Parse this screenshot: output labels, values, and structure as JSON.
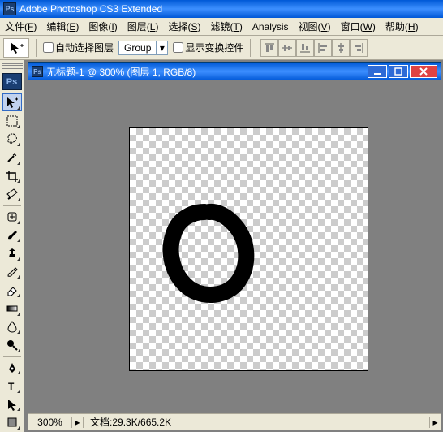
{
  "app": {
    "title": "Adobe Photoshop CS3 Extended"
  },
  "menu": [
    {
      "label": "文件",
      "acc": "F"
    },
    {
      "label": "编辑",
      "acc": "E"
    },
    {
      "label": "图像",
      "acc": "I"
    },
    {
      "label": "图层",
      "acc": "L"
    },
    {
      "label": "选择",
      "acc": "S"
    },
    {
      "label": "滤镜",
      "acc": "T"
    },
    {
      "label": "Analysis",
      "acc": ""
    },
    {
      "label": "视图",
      "acc": "V"
    },
    {
      "label": "窗口",
      "acc": "W"
    },
    {
      "label": "帮助",
      "acc": "H"
    }
  ],
  "options": {
    "auto_select_label": "自动选择图层",
    "group_value": "Group",
    "show_transform_label": "显示变换控件"
  },
  "document": {
    "title": "无标题-1 @ 300% (图层 1, RGB/8)",
    "zoom": "300%",
    "doc_label": "文档:",
    "doc_size": "29.3K/665.2K"
  }
}
